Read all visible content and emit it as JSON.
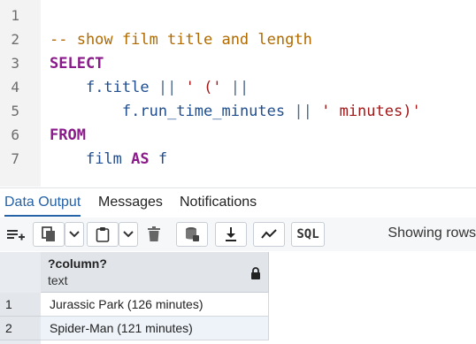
{
  "editor": {
    "line_numbers": [
      "1",
      "2",
      "3",
      "4",
      "5",
      "6",
      "7"
    ],
    "line2": {
      "comment": "-- show film title and length"
    },
    "line3": {
      "keyword": "SELECT"
    },
    "line4": {
      "field": "f.title",
      "op1": "||",
      "string": "' ('",
      "op2": "||"
    },
    "line5": {
      "field": "f.run_time_minutes",
      "op": "||",
      "string": "' minutes)'"
    },
    "line6": {
      "keyword": "FROM"
    },
    "line7": {
      "table": "film",
      "keyword": "AS",
      "alias": "f"
    }
  },
  "tabs": [
    "Data Output",
    "Messages",
    "Notifications"
  ],
  "toolbar": {
    "sql_label": "SQL",
    "status": "Showing rows",
    "icons": [
      "add-row-icon",
      "copy-icon",
      "chevron-down-icon",
      "paste-icon",
      "chevron-down-icon",
      "delete-icon",
      "save-data-icon",
      "download-icon",
      "graph-icon"
    ]
  },
  "grid": {
    "column_name": "?column?",
    "column_type": "text",
    "rows": [
      {
        "num": "1",
        "value": "Jurassic Park (126 minutes)"
      },
      {
        "num": "2",
        "value": "Spider-Man (121 minutes)"
      }
    ]
  },
  "colors": {
    "keyword": "#8a1a8a",
    "comment": "#b06a00",
    "string": "#a01818",
    "accent": "#2563a6"
  }
}
